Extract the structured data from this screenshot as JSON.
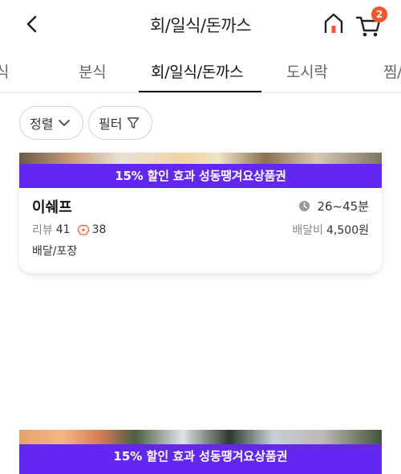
{
  "header": {
    "title": "회/일식/돈까스",
    "cart_count": "2",
    "icons": [
      "chevron-left-icon",
      "home-icon",
      "cart-icon"
    ]
  },
  "tabs": [
    {
      "label": "식"
    },
    {
      "label": "분식"
    },
    {
      "label": "회/일식/돈까스"
    },
    {
      "label": "도시락"
    },
    {
      "label": "찜/"
    }
  ],
  "filters": {
    "sort_label": "정렬",
    "filter_label": "필터"
  },
  "stores": [
    {
      "promo": "15% 할인 효과 성동땡겨요상품권",
      "name": "이쉐프",
      "time": "26~45분",
      "review_label": "리뷰",
      "review_count": "41",
      "like_count": "38",
      "fee_label": "배달비",
      "fee": "4,500원",
      "delivery_type": "배달/포장"
    },
    {
      "promo": "15% 할인 효과 성동땡겨요상품권"
    }
  ],
  "colors": {
    "accent": "#f2562a",
    "promo_bg": "#6327f2",
    "active_tab": "#111111"
  }
}
